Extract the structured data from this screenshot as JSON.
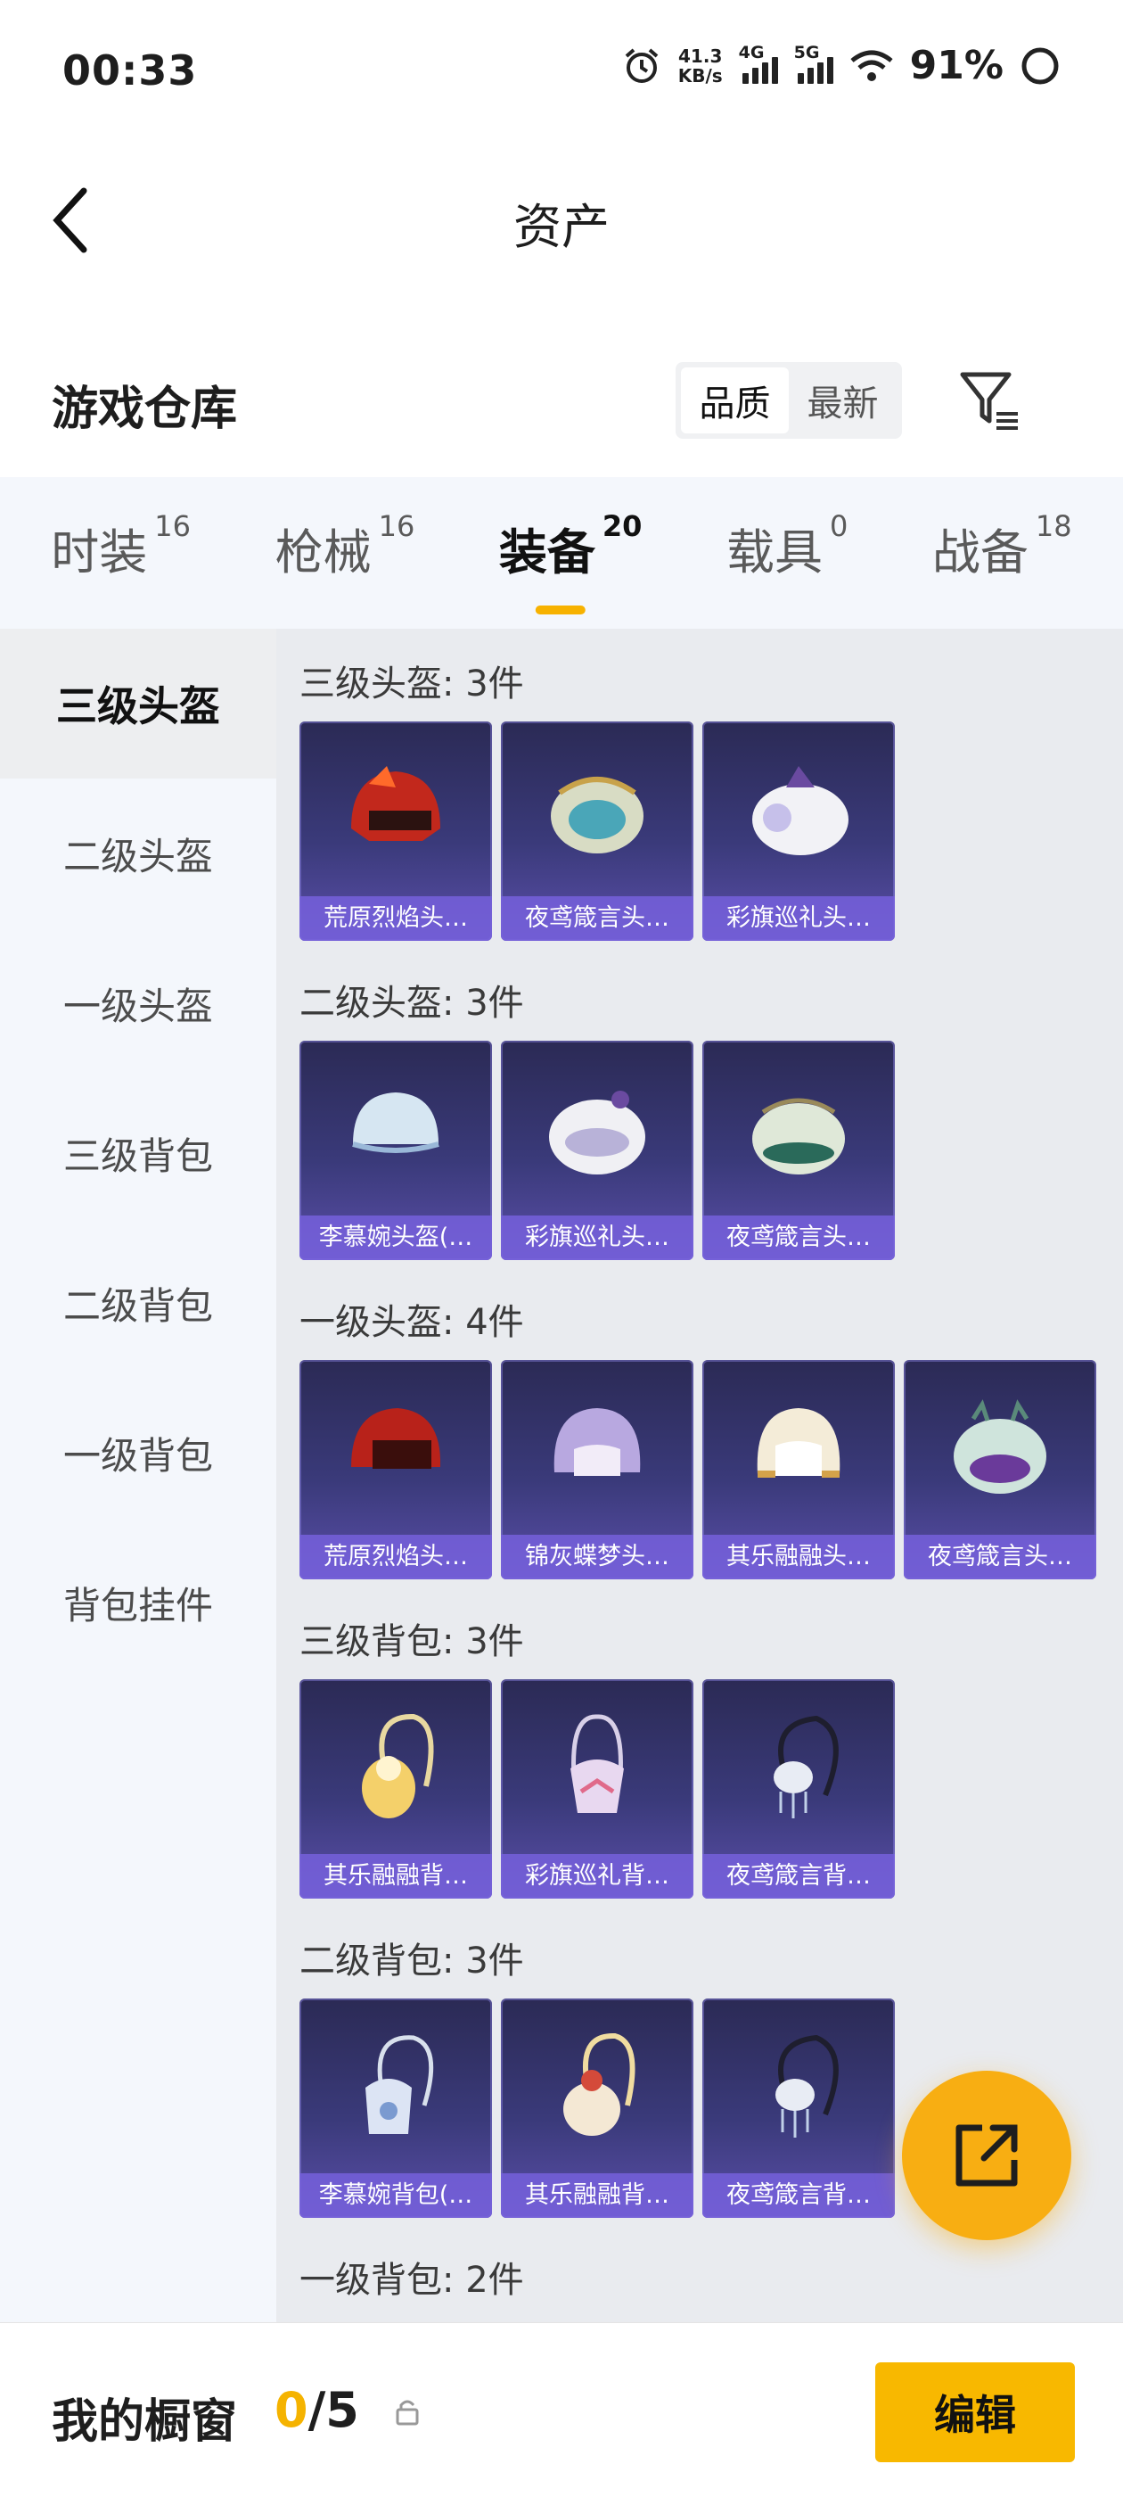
{
  "status_bar": {
    "time": "00:33",
    "net_speed": "41.3",
    "net_unit": "KB/s",
    "sig1": "4G",
    "sig2": "5G",
    "battery": "91%"
  },
  "header": {
    "title": "资产"
  },
  "warehouse": {
    "title": "游戏仓库",
    "sort_options": [
      "品质",
      "最新"
    ],
    "active_sort": "品质"
  },
  "tabs": [
    {
      "label": "时装",
      "count": "16"
    },
    {
      "label": "枪械",
      "count": "16"
    },
    {
      "label": "装备",
      "count": "20"
    },
    {
      "label": "载具",
      "count": "0"
    },
    {
      "label": "战备",
      "count": "18"
    }
  ],
  "sidenav": [
    "三级头盔",
    "二级头盔",
    "一级头盔",
    "三级背包",
    "二级背包",
    "一级背包",
    "背包挂件"
  ],
  "sections": [
    {
      "title": "三级头盔: 3件",
      "items": [
        "荒原烈焰头…",
        "夜鸢箴言头…",
        "彩旗巡礼头…"
      ]
    },
    {
      "title": "二级头盔: 3件",
      "items": [
        "李慕婉头盔(…",
        "彩旗巡礼头…",
        "夜鸢箴言头…"
      ]
    },
    {
      "title": "一级头盔: 4件",
      "items": [
        "荒原烈焰头…",
        "锦灰蝶梦头…",
        "其乐融融头…",
        "夜鸢箴言头…"
      ]
    },
    {
      "title": "三级背包: 3件",
      "items": [
        "其乐融融背…",
        "彩旗巡礼背…",
        "夜鸢箴言背…"
      ]
    },
    {
      "title": "二级背包: 3件",
      "items": [
        "李慕婉背包(…",
        "其乐融融背…",
        "夜鸢箴言背…"
      ]
    },
    {
      "title": "一级背包: 2件",
      "items": []
    }
  ],
  "bottom": {
    "label": "我的橱窗",
    "current": "0",
    "total": "/5",
    "edit": "编辑"
  },
  "colors": {
    "accent": "#f8b800",
    "card": "#3a3a7a",
    "card_label": "#7660dc"
  }
}
